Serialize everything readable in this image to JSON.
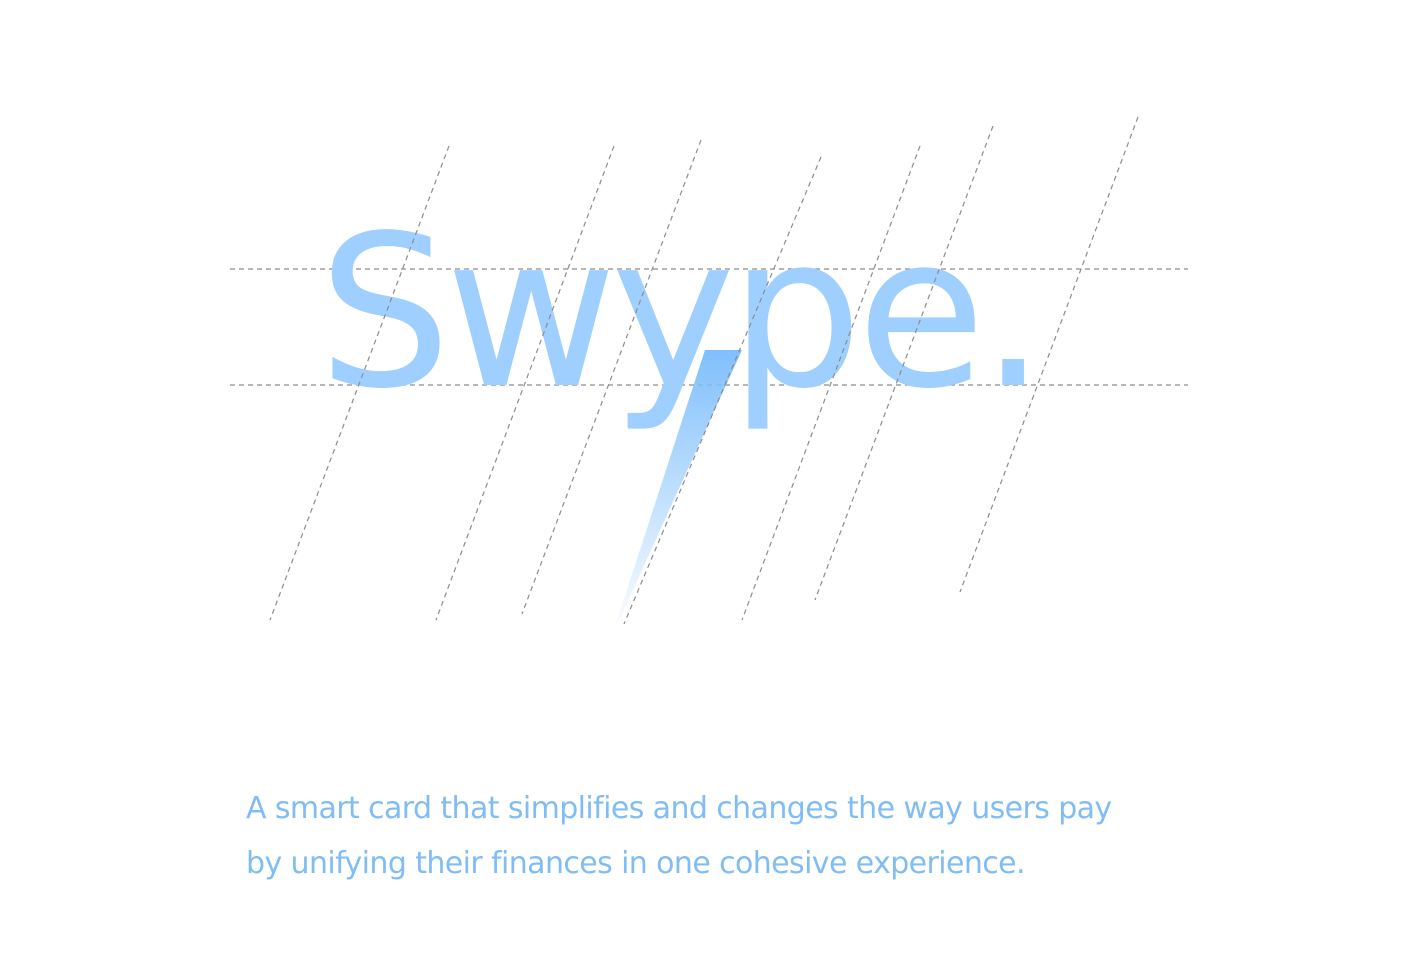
{
  "logo": {
    "wordmark": "Swype.",
    "color": "#9ecfff",
    "accent_color": "#80bffc"
  },
  "tagline": {
    "line1": "A smart card that simplifies and changes the way users pay",
    "line2": "by unifying their finances in one cohesive experience.",
    "color": "#80bdf4"
  },
  "guides": {
    "color": "#8c8c8c"
  }
}
